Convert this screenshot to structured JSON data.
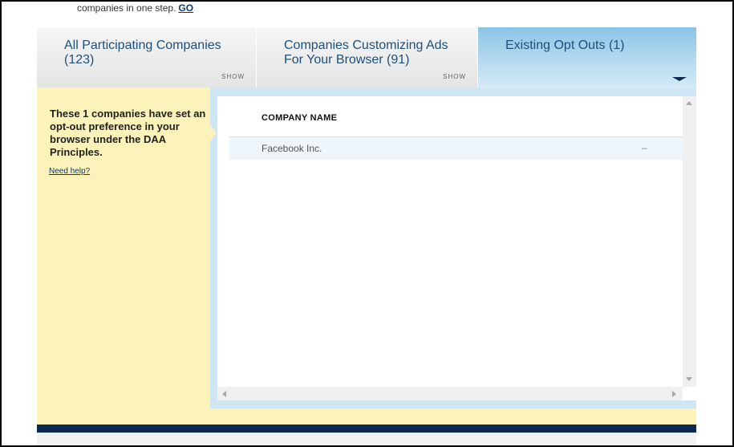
{
  "intro": {
    "text": "companies in one step.",
    "go_link": "GO"
  },
  "tabs": [
    {
      "title": "All Participating Companies (123)",
      "show": "SHOW"
    },
    {
      "title": "Companies Customizing Ads For Your Browser (91)",
      "show": "SHOW"
    },
    {
      "title": "Existing Opt Outs (1)"
    }
  ],
  "sidebar": {
    "message": "These 1 companies have set an opt-out preference in your browser under the DAA Principles.",
    "help_link": "Need help?"
  },
  "table": {
    "column_header": "COMPANY NAME",
    "rows": [
      {
        "name": "Facebook Inc.",
        "status": "–"
      }
    ]
  },
  "colors": {
    "active_tab": "#b8dcf0",
    "sidebar_bg": "#fbf3b9",
    "footer_bar": "#0b2a52",
    "link": "#0b3a6e"
  }
}
